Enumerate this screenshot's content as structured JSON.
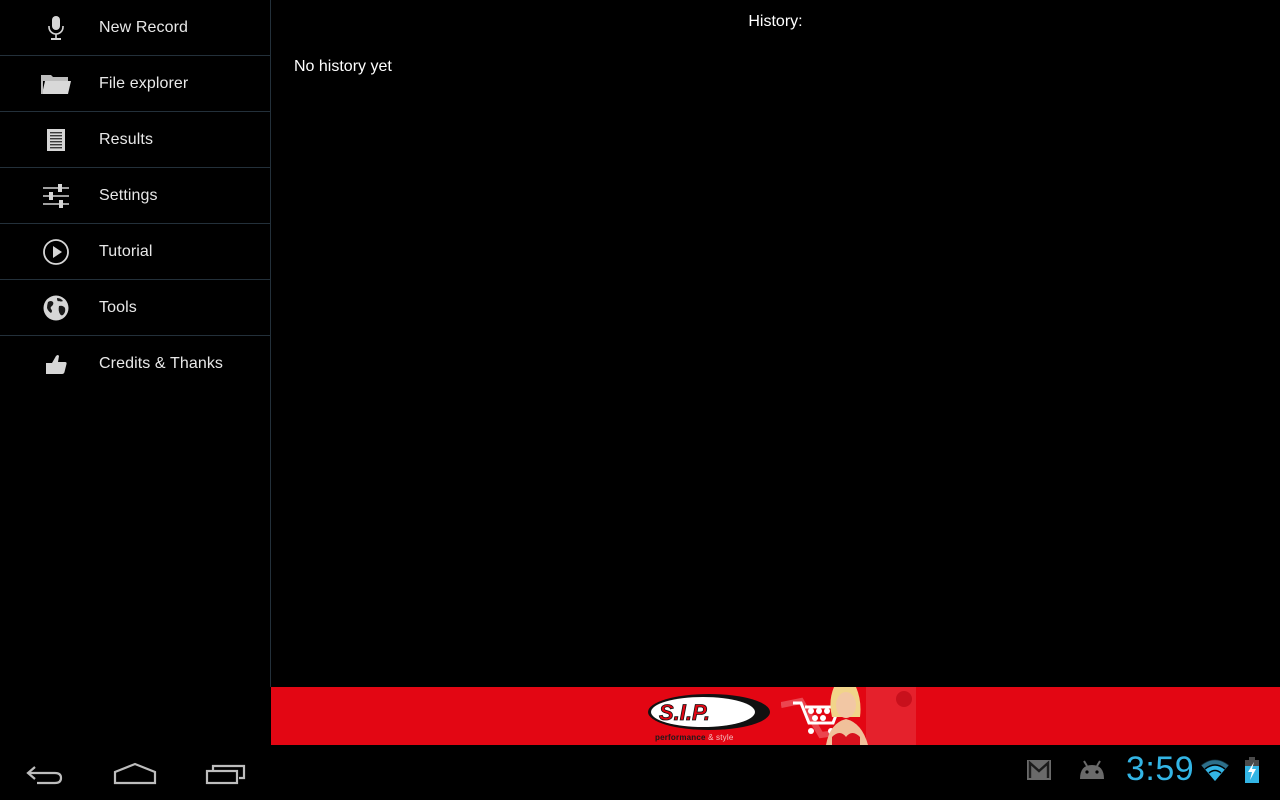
{
  "sidebar": {
    "items": [
      {
        "label": "New Record",
        "icon": "microphone-icon"
      },
      {
        "label": "File explorer",
        "icon": "folder-icon"
      },
      {
        "label": "Results",
        "icon": "document-icon"
      },
      {
        "label": "Settings",
        "icon": "sliders-icon"
      },
      {
        "label": "Tutorial",
        "icon": "play-circle-icon"
      },
      {
        "label": "Tools",
        "icon": "globe-icon"
      },
      {
        "label": "Credits & Thanks",
        "icon": "thumbs-up-icon"
      }
    ]
  },
  "main": {
    "title": "History:",
    "empty_message": "No history yet"
  },
  "ad": {
    "brand": "S.I.P.",
    "tagline_bold": "performance",
    "tagline_rest": " & style",
    "background_color": "#e30613"
  },
  "navbar": {
    "buttons": [
      {
        "name": "back",
        "icon": "back-icon"
      },
      {
        "name": "home",
        "icon": "home-icon"
      },
      {
        "name": "recents",
        "icon": "recent-apps-icon"
      }
    ]
  },
  "status_bar": {
    "time": "3:59",
    "notifications": [
      "gmail-icon",
      "android-debug-icon"
    ],
    "wifi": "wifi-icon",
    "battery": "battery-charging-icon",
    "accent_color": "#33b5e5"
  }
}
